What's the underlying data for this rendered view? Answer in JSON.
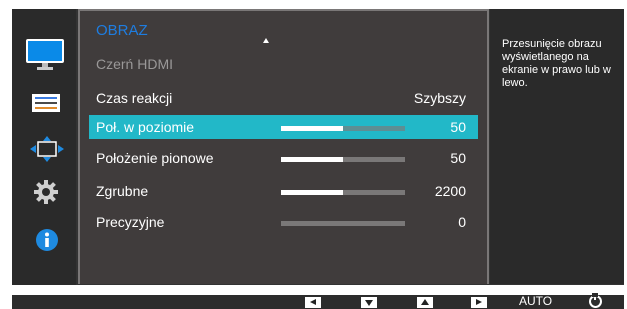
{
  "menu": {
    "title": "OBRAZ",
    "items": [
      {
        "label": "Czerń HDMI",
        "value": "",
        "disabled": true,
        "selected": false,
        "level": null
      },
      {
        "label": "Czas reakcji",
        "value": "Szybszy",
        "disabled": false,
        "selected": false,
        "level": null
      },
      {
        "label": "Poł. w poziomie",
        "value": "50",
        "disabled": false,
        "selected": true,
        "level": 0.5
      },
      {
        "label": "Położenie pionowe",
        "value": "50",
        "disabled": false,
        "selected": false,
        "level": 0.5
      },
      {
        "label": "Zgrubne",
        "value": "2200",
        "disabled": false,
        "selected": false,
        "level": 0.5
      },
      {
        "label": "Precyzyjne",
        "value": "0",
        "disabled": false,
        "selected": false,
        "level": 0.0
      }
    ]
  },
  "help": {
    "text": "Przesunięcie obrazu wyświetlanego na ekranie w prawo lub w lewo."
  },
  "sidebar_icons": [
    "monitor-icon",
    "list-settings-icon",
    "move-arrows-icon",
    "gear-icon",
    "info-icon"
  ],
  "bottom_bar": {
    "buttons": [
      "left-button",
      "down-button",
      "up-button",
      "right-button"
    ],
    "auto_label": "AUTO"
  },
  "colors": {
    "accent": "#1e7de0",
    "selected": "#22b8c8",
    "panel": "#403c3c"
  }
}
